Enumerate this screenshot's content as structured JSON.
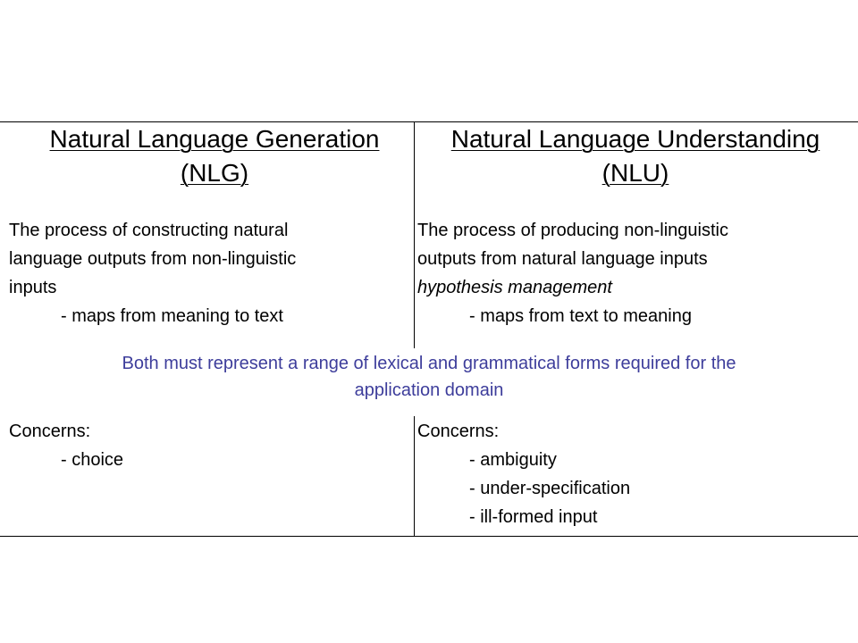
{
  "nlg": {
    "title_line1": "Natural Language Generation",
    "title_line2": "(NLG)",
    "description": [
      "The process of constructing natural",
      "language outputs from non-linguistic",
      "inputs"
    ],
    "mapping": "- maps from meaning to text",
    "concerns_label": "Concerns:",
    "concerns": [
      "- choice"
    ]
  },
  "nlu": {
    "title_line1": "Natural Language Understanding",
    "title_line2": "(NLU)",
    "description": [
      "The process of producing non-linguistic",
      "outputs from natural language inputs"
    ],
    "italic_note": "hypothesis management",
    "mapping": "- maps from text to meaning",
    "concerns_label": "Concerns:",
    "concerns": [
      "- ambiguity",
      "- under-specification",
      "- ill-formed input"
    ]
  },
  "shared": {
    "line1": "Both must represent a range of lexical and grammatical forms required for the",
    "line2": "application domain"
  },
  "colors": {
    "shared_text": "#3d3d9b",
    "rules": "#000000"
  }
}
